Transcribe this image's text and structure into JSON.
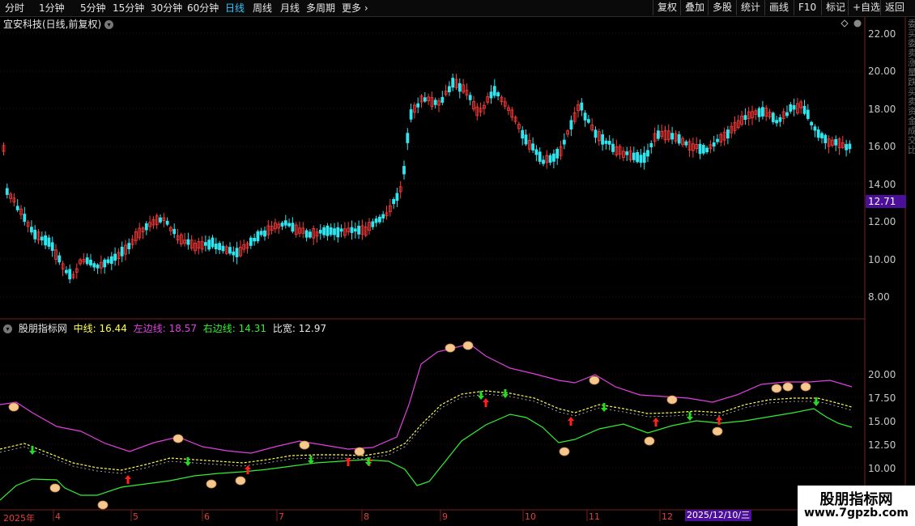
{
  "toolbar": {
    "periods": [
      "分时",
      "1分钟",
      "5分钟",
      "15分钟",
      "30分钟",
      "60分钟",
      "日线",
      "周线",
      "月线",
      "多周期",
      "更多"
    ],
    "active_period": "日线",
    "right_buttons": [
      "复权",
      "叠加",
      "多股",
      "统计",
      "画线",
      "F10",
      "标记",
      "+自选",
      "返回"
    ]
  },
  "main_panel": {
    "title": "宜安科技(日线,前复权)",
    "price_ticks": [
      "22.00",
      "20.00",
      "18.00",
      "16.00",
      "14.00",
      "12.00",
      "10.00",
      "8.00"
    ],
    "current_price_badge": "12.71",
    "side_text": "委买委卖涨量跌买卖资金成交比"
  },
  "indicator_panel": {
    "name": "股朋指标网",
    "mid_label": "中线:",
    "mid_value": "16.44",
    "left_label": "左边线:",
    "left_value": "18.57",
    "right_label": "右边线:",
    "right_value": "14.31",
    "ratio_label": "比宽:",
    "ratio_value": "12.97",
    "ticks": [
      "20.00",
      "17.50",
      "15.00",
      "12.50",
      "10.00"
    ]
  },
  "date_axis": {
    "labels": [
      "2025年",
      "4",
      "5",
      "6",
      "7",
      "8",
      "9",
      "10",
      "11",
      "12"
    ],
    "cursor_date": "2025/12/10/三"
  },
  "watermark": {
    "title": "股朋指标网",
    "url": "www.7gpzb.com"
  },
  "colors": {
    "up": "#ff3b3b",
    "down": "#2ee6f0",
    "mid_line": "#ffff4d",
    "left_line": "#e040e0",
    "right_line": "#33ee33",
    "active": "#2ec8ff"
  }
}
